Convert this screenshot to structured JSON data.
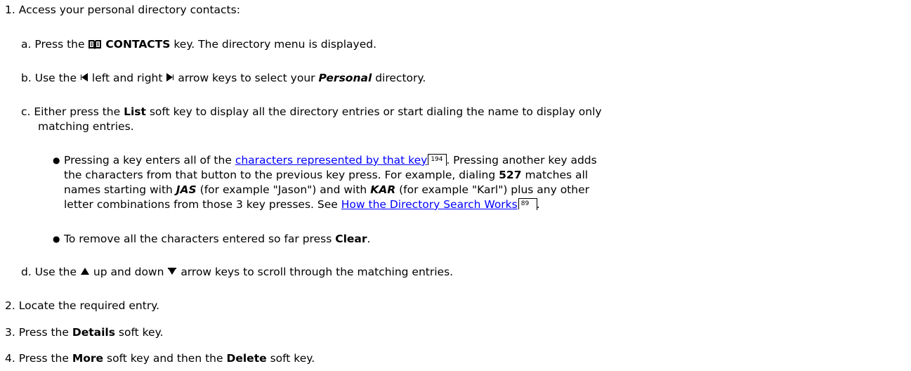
{
  "steps": {
    "s1": {
      "num": "1.",
      "text": "Access your personal directory contacts:"
    },
    "a": {
      "letter": "a.",
      "pre": "Press the",
      "key": "CONTACTS",
      "post": "key. The directory menu is displayed."
    },
    "b": {
      "letter": "b.",
      "pre": "Use the",
      "mid": "left and right",
      "post1": "arrow keys to select your",
      "dir": "Personal",
      "post2": "directory."
    },
    "c": {
      "letter": "c.",
      "pre": "Either press the",
      "key": "List",
      "post1": "soft key to display all the directory entries or start dialing the name to display only",
      "post2": "matching entries."
    },
    "bullet1": {
      "l1_pre": "Pressing a key enters all of the",
      "l1_link": "characters represented by that key",
      "l1_ref": "194",
      "l1_post": ". Pressing another key adds",
      "l2": "the characters from that button to the previous key press. For example, dialing",
      "l2_num": "527",
      "l2_post": "matches all",
      "l3_pre": "names starting with",
      "l3_jas": "JAS",
      "l3_mid": "(for example \"Jason\") and with",
      "l3_kar": "KAR",
      "l3_post": "(for example \"Karl\") plus any other",
      "l4_pre": "letter combinations from those 3 key presses. See",
      "l4_link": "How the Directory Search Works",
      "l4_ref": "89",
      "l4_post": "."
    },
    "bullet2": {
      "pre": "To remove all the characters entered so far press",
      "key": "Clear",
      "post": "."
    },
    "d": {
      "letter": "d.",
      "pre": "Use the",
      "mid": "up and down",
      "post": "arrow keys to scroll through the matching entries."
    },
    "s2": {
      "num": "2.",
      "text": "Locate the required entry."
    },
    "s3": {
      "num": "3.",
      "pre": "Press the",
      "key": "Details",
      "post": "soft key."
    },
    "s4": {
      "num": "4.",
      "pre": "Press the",
      "key1": "More",
      "mid": "soft key and then the",
      "key2": "Delete",
      "post": "soft key."
    }
  },
  "icons": {
    "book": "contacts-book-icon",
    "left": "left-arrow-icon",
    "right": "right-arrow-icon",
    "up": "up-arrow-icon",
    "down": "down-arrow-icon"
  }
}
